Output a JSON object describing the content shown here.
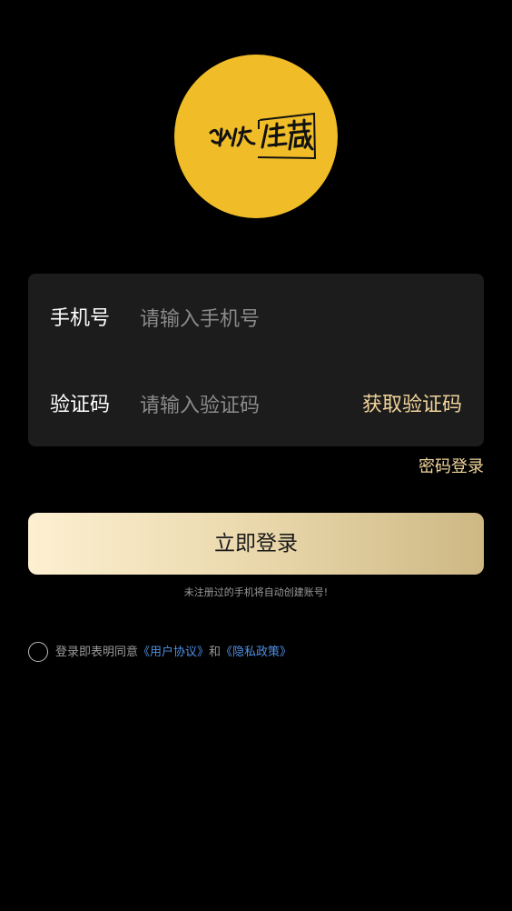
{
  "logo": {
    "text": "必优佳藏",
    "bg_color": "#f0bd28"
  },
  "form": {
    "phone": {
      "label": "手机号",
      "placeholder": "请输入手机号",
      "value": ""
    },
    "code": {
      "label": "验证码",
      "placeholder": "请输入验证码",
      "value": "",
      "get_code_label": "获取验证码"
    }
  },
  "password_login_label": "密码登录",
  "login_button_label": "立即登录",
  "auto_register_hint": "未注册过的手机将自动创建账号!",
  "agreement": {
    "checked": false,
    "prefix": "登录即表明同意",
    "user_agreement": "《用户协议》",
    "conjunction": "和",
    "privacy_policy": "《隐私政策》"
  },
  "colors": {
    "background": "#000000",
    "card": "#1c1c1c",
    "accent_gold": "#f1d49a",
    "link_blue": "#4f8fe3"
  }
}
